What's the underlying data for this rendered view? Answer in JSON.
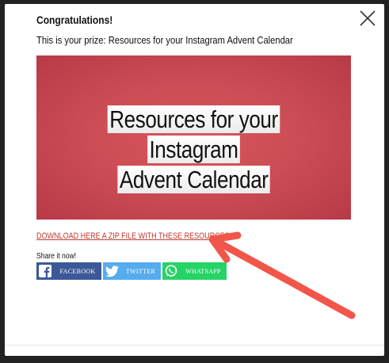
{
  "modal": {
    "title": "Congratulations!",
    "subtitle": "This is your prize: Resources for your Instagram Advent Calendar",
    "banner_line1": "Resources for your Instagram",
    "banner_line2": "Advent Calendar",
    "download_link": "DOWNLOAD HERE A ZIP FILE WITH THESE RESOURCES",
    "share_label": "Share it now!",
    "close_icon": "close-icon"
  },
  "share_buttons": [
    {
      "label": "FACEBOOK",
      "icon": "facebook-icon",
      "color": "#3b5998"
    },
    {
      "label": "TWITTER",
      "icon": "twitter-icon",
      "color": "#55acee"
    },
    {
      "label": "WHATSAPP",
      "icon": "whatsapp-icon",
      "color": "#25d366"
    }
  ],
  "colors": {
    "banner": "#cc4d55",
    "link": "#c0392b",
    "arrow": "#f2564a"
  }
}
